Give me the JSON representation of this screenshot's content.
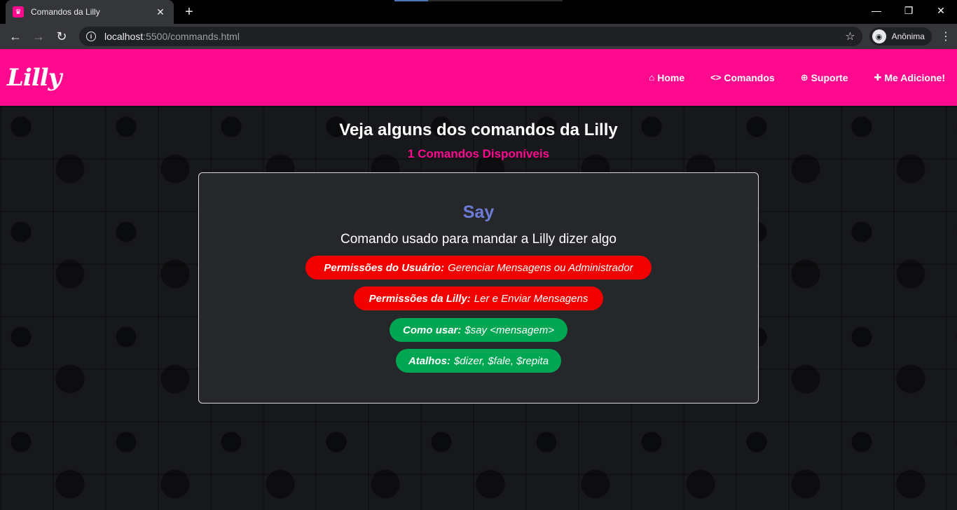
{
  "browser": {
    "tab_title": "Comandos da Lilly",
    "url_host": "localhost",
    "url_path": ":5500/commands.html",
    "profile_label": "Anônima"
  },
  "site": {
    "logo": "Lilly",
    "nav": [
      {
        "icon": "home-icon",
        "label": "Home"
      },
      {
        "icon": "code-icon",
        "label": "Comandos"
      },
      {
        "icon": "lifebuoy-icon",
        "label": "Suporte"
      },
      {
        "icon": "plus-icon",
        "label": "Me Adicione!"
      }
    ]
  },
  "main": {
    "heading": "Veja alguns dos comandos da Lilly",
    "subheading": "1 Comandos Disponíveis",
    "command": {
      "name": "Say",
      "description": "Comando usado para mandar a Lilly dizer algo",
      "user_permissions": {
        "label": "Permissões do Usuário:",
        "value": "Gerenciar Mensagens ou Administrador"
      },
      "bot_permissions": {
        "label": "Permissões da Lilly:",
        "value": "Ler e Enviar Mensagens"
      },
      "usage": {
        "label": "Como usar:",
        "value": "$say <mensagem>"
      },
      "aliases": {
        "label": "Atalhos:",
        "value": "$dizer, $fale, $repita"
      }
    }
  },
  "colors": {
    "brand": "#ff0a8f",
    "command_name": "#6b7bd6",
    "permission_pill": "#f20000",
    "usage_pill": "#00a651"
  }
}
